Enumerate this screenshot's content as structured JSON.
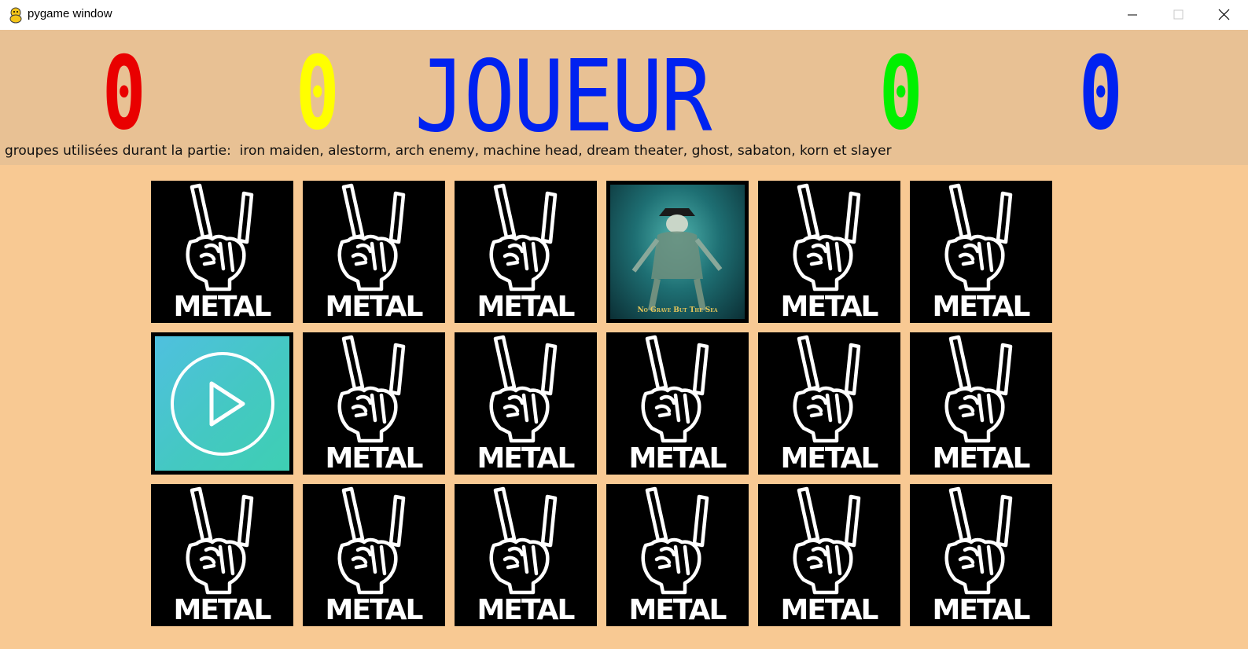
{
  "window": {
    "title": "pygame window",
    "icon": "pygame-snake-icon",
    "controls": [
      "minimize-icon",
      "maximize-icon",
      "close-icon"
    ]
  },
  "header": {
    "scores": {
      "red": "0",
      "yellow": "0",
      "green": "0",
      "blue": "0"
    },
    "player_label": "JOUEUR",
    "bands_line": "groupes utilisées durant la partie:  iron maiden, alestorm, arch enemy, machine head, dream theater, ghost, sabaton, korn et slayer",
    "colors": {
      "red": "#e90000",
      "yellow": "#ffff00",
      "green": "#00f000",
      "blue": "#0022f0",
      "band_bg": "#e8c194",
      "page_bg": "#f8c993"
    }
  },
  "board": {
    "rows": 3,
    "cols": 6,
    "card_back_text": "METAL",
    "card_back_icon": "horns-hand-icon",
    "revealed_card": {
      "row": 0,
      "col": 3,
      "album_caption": "No Grave But The Sea"
    },
    "play_card": {
      "row": 1,
      "col": 0,
      "icon": "play-icon"
    }
  }
}
